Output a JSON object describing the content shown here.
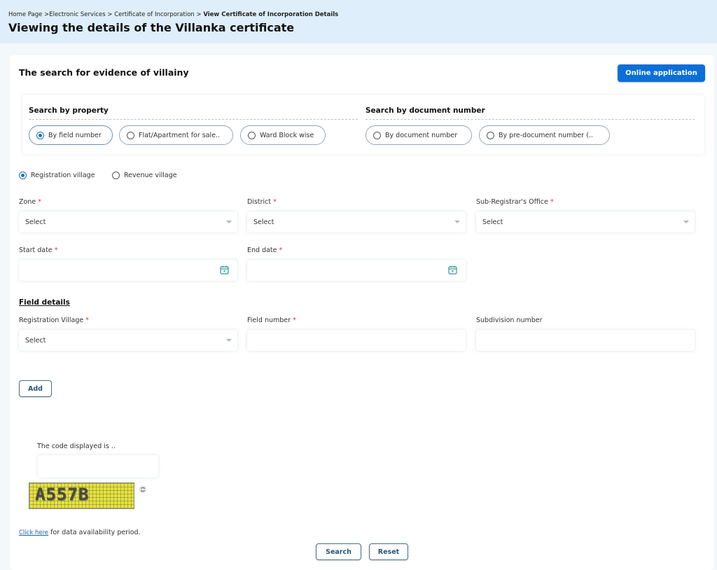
{
  "breadcrumb": {
    "items": [
      "Home Page >",
      "Electronic Services >",
      "Certificate of Incorporation >"
    ],
    "current": "View Certificate of Incorporation Details"
  },
  "page_title": "Viewing the details of the Villanka certificate",
  "card": {
    "title": "The search for evidence of villainy",
    "online_button": "Online application"
  },
  "search_by_property": {
    "heading": "Search by property",
    "options": [
      "By field number",
      "Flat/Apartment for sale..",
      "Ward Block wise"
    ],
    "selected": "By field number"
  },
  "search_by_document": {
    "heading": "Search by document number",
    "options": [
      "By document number",
      "By pre-document number (.."
    ]
  },
  "village_type": {
    "options": [
      "Registration village",
      "Revenue village"
    ],
    "selected": "Registration village"
  },
  "fields": {
    "zone": {
      "label": "Zone",
      "value": "Select"
    },
    "district": {
      "label": "District",
      "value": "Select"
    },
    "sro": {
      "label": "Sub-Registrar's Office",
      "value": "Select"
    },
    "start_date": {
      "label": "Start date",
      "value": ""
    },
    "end_date": {
      "label": "End date",
      "value": ""
    }
  },
  "field_details": {
    "heading": "Field details",
    "registration_village": {
      "label": "Registration Village",
      "value": "Select"
    },
    "field_number": {
      "label": "Field number",
      "value": ""
    },
    "subdivision_number": {
      "label": "Subdivision number",
      "value": ""
    }
  },
  "required_mark": "*",
  "add_button": "Add",
  "captcha": {
    "label": "The code displayed is ..",
    "code": "A557B"
  },
  "data_note": {
    "link": "Click here",
    "text": " for data availability period."
  },
  "search_button": "Search",
  "reset_button": "Reset",
  "colors": {
    "primary": "#0b6fd8",
    "required": "#d9363e",
    "header_band": "#deeefa"
  }
}
